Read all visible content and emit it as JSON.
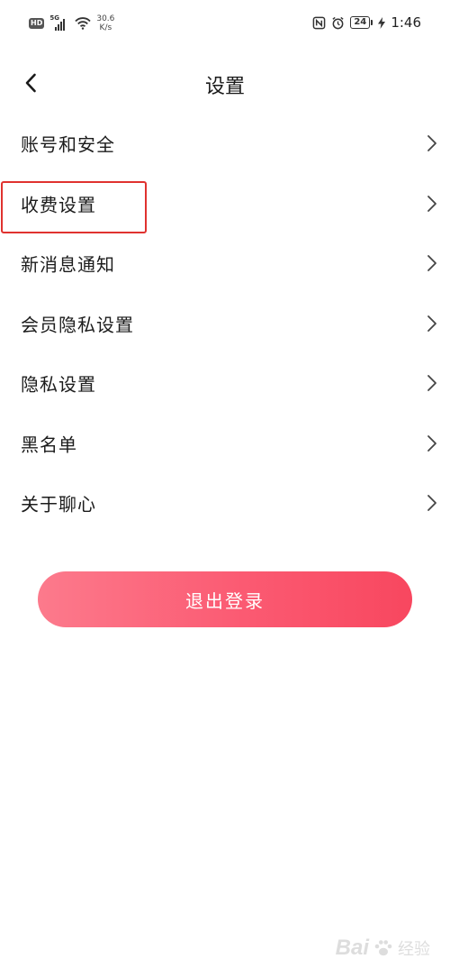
{
  "status_bar": {
    "hd_label": "HD",
    "signal_label": "5G",
    "net_speed_value": "30.6",
    "net_speed_unit": "K/s",
    "battery_level": "24",
    "time": "1:46"
  },
  "header": {
    "title": "设置"
  },
  "settings": {
    "items": [
      {
        "label": "账号和安全"
      },
      {
        "label": "收费设置"
      },
      {
        "label": "新消息通知"
      },
      {
        "label": "会员隐私设置"
      },
      {
        "label": "隐私设置"
      },
      {
        "label": "黑名单"
      },
      {
        "label": "关于聊心"
      }
    ],
    "highlighted_index": 1
  },
  "logout": {
    "label": "退出登录"
  },
  "watermark": {
    "brand": "Bai",
    "suffix": "经验"
  },
  "colors": {
    "accent": "#fb5a72",
    "highlight": "#e0322f"
  }
}
